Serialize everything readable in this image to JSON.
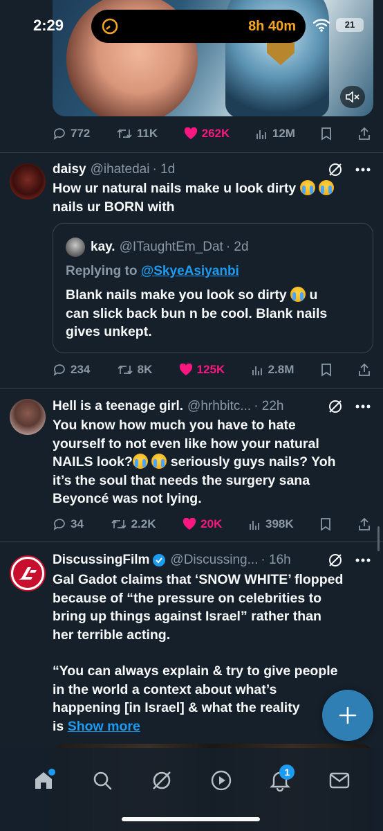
{
  "status_bar": {
    "time": "2:29",
    "timer": "8h 40m",
    "battery": "21"
  },
  "tweets": [
    {
      "actions": {
        "replies": "772",
        "retweets": "11K",
        "likes": "262K",
        "views": "12M"
      }
    },
    {
      "name": "daisy",
      "handle": "@ihatedai",
      "time": "· 1d",
      "text_line1": "How ur natural nails make u look dirty",
      "text_line2": "nails ur BORN with",
      "quote": {
        "name": "kay.",
        "handle": "@ITaughtEm_Dat",
        "time": "· 2d",
        "replying_prefix": "Replying to",
        "replying_to": "@SkyeAsiyanbi",
        "text_line1_a": "Blank nails make you look so dirty",
        "text_line1_b": "u",
        "text_line2": "can slick back bun n be cool. Blank nails",
        "text_line3": "gives unkept."
      },
      "actions": {
        "replies": "234",
        "retweets": "8K",
        "likes": "125K",
        "views": "2.8M"
      }
    },
    {
      "name": "Hell is a teenage girl.",
      "handle": "@hrhbitc...",
      "time": "· 22h",
      "text_line1": "You know how much you have to hate",
      "text_line2": "yourself to not even like how your natural",
      "text_line3a": "NAILS look?",
      "text_line3b": "seriously guys nails? Yoh",
      "text_line4": "it’s the soul that needs the surgery sana",
      "text_line5": "Beyoncé was not lying.",
      "actions": {
        "replies": "34",
        "retweets": "2.2K",
        "likes": "20K",
        "views": "398K"
      }
    },
    {
      "name": "DiscussingFilm",
      "handle": "@Discussing...",
      "time": "· 16h",
      "text_line1": "Gal Gadot claims that ‘SNOW WHITE’ flopped",
      "text_line2": "because of “the pressure on celebrities to",
      "text_line3": "bring up things against Israel” rather than",
      "text_line4": "her terrible acting.",
      "text_line5": "“You can always explain & try to give people",
      "text_line6": "in the world a context about what’s",
      "text_line7": "happening [in Israel] & what the reality",
      "text_line8_prefix": "is",
      "show_more": "Show more"
    }
  ],
  "notifications_count": "1",
  "colors": {
    "background": "#15202b",
    "accent": "#1d9bf0",
    "like": "#f91880",
    "muted": "#8b98a5",
    "timer": "#f5a623"
  },
  "nav": [
    "home-icon",
    "search-icon",
    "grok-icon",
    "play-icon",
    "bell-icon",
    "mail-icon"
  ]
}
